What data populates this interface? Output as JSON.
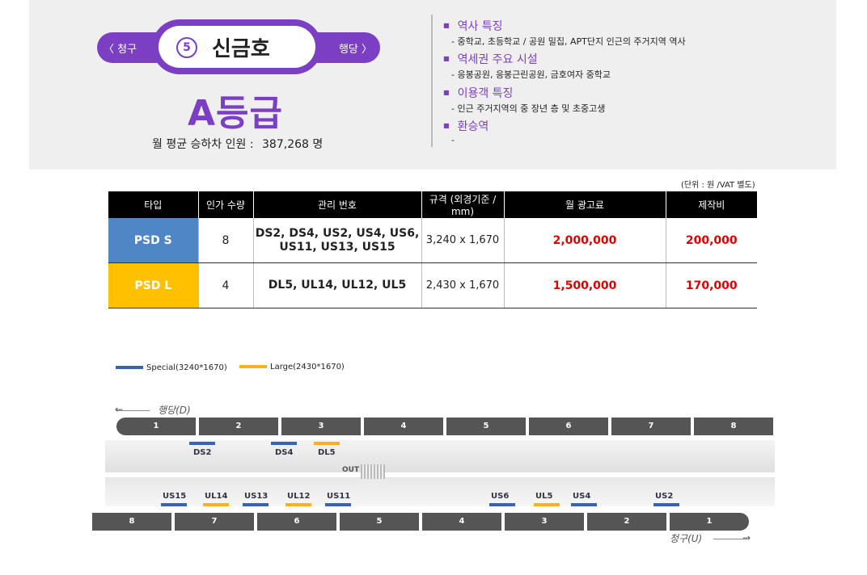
{
  "station": {
    "prev": "〈 청구",
    "next": "행당 〉",
    "number": "5",
    "name": "신금호",
    "grade": "A등급",
    "monthly_label": "월 평균 승하차 인원 :",
    "monthly_value": "387,268 명"
  },
  "info": [
    {
      "head": "역사 특징",
      "desc": "-  중학교, 초등학교 / 공원 밀집, APT단지 인근의 주거지역 역사"
    },
    {
      "head": "역세권 주요 시설",
      "desc": "-  응봉공원, 응봉근린공원, 금호여자 중학교"
    },
    {
      "head": "이용객 특징",
      "desc": "-  인근 주거지역의 중 장년 층 및 초중고생"
    },
    {
      "head": "환승역",
      "desc": "-"
    }
  ],
  "unit": "(단위 : 원 /VAT 별도)",
  "table": {
    "headers": [
      "타입",
      "인가 수량",
      "관리 번호",
      "규격 (외경기준 / mm)",
      "월 광고료",
      "제작비"
    ],
    "rows": [
      {
        "type": "PSD S",
        "qty": "8",
        "codes1": "DS2, DS4, US2, US4, US6,",
        "codes2": "US11, US13, US15",
        "size": "3,240 x 1,670",
        "fee": "2,000,000",
        "prod": "200,000"
      },
      {
        "type": "PSD L",
        "qty": "4",
        "codes1": "DL5, UL14, UL12, UL5",
        "codes2": "",
        "size": "2,430 x 1,670",
        "fee": "1,500,000",
        "prod": "170,000"
      }
    ]
  },
  "legend": {
    "special": "Special(3240*1670)",
    "large": "Large(2430*1670)"
  },
  "colors": {
    "purple": "#7b3fc4",
    "special": "#3a63b5",
    "large": "#ffb020",
    "price": "#e00000"
  },
  "map": {
    "dir_top": "행당(D)",
    "dir_bottom": "청구(U)",
    "out_label": "OUT",
    "top_cars": [
      "1",
      "2",
      "3",
      "4",
      "5",
      "6",
      "7",
      "8"
    ],
    "bottom_cars": [
      "8",
      "7",
      "6",
      "5",
      "4",
      "3",
      "2",
      "1"
    ],
    "top_ads": [
      "DS2",
      "DS4",
      "DL5"
    ],
    "bottom_ads": [
      "US15",
      "UL14",
      "US13",
      "UL12",
      "US11",
      "US6",
      "UL5",
      "US4",
      "US2"
    ]
  }
}
